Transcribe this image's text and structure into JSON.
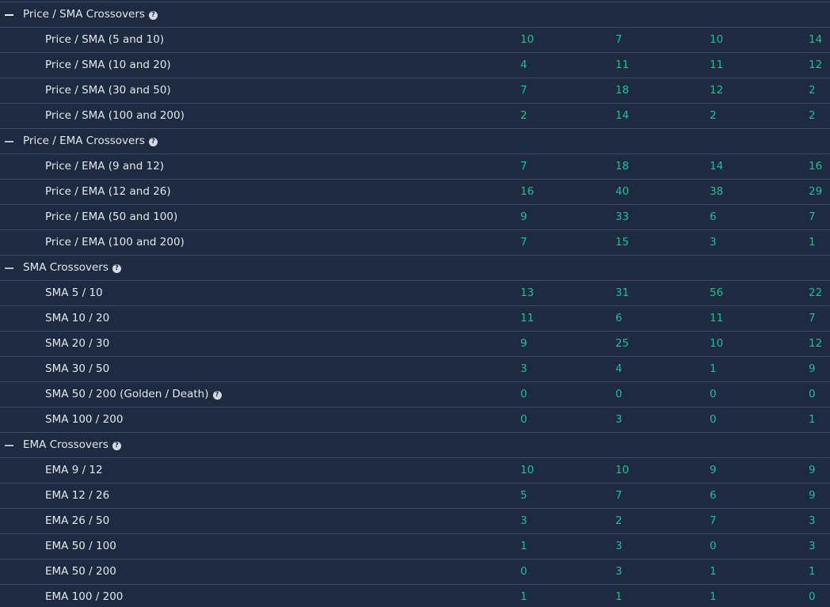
{
  "colors": {
    "background": "#1d2a3f",
    "divider": "#3b4a60",
    "label_text": "#e3e7ed",
    "value_text": "#1fbf9f"
  },
  "groups": [
    {
      "title": "Price / SMA Crossovers",
      "help_icon": "question-circle-icon",
      "rows": [
        {
          "label": "Price / SMA (5 and 10)",
          "values": [
            "10",
            "7",
            "10",
            "14"
          ]
        },
        {
          "label": "Price / SMA (10 and 20)",
          "values": [
            "4",
            "11",
            "11",
            "12"
          ]
        },
        {
          "label": "Price / SMA (30 and 50)",
          "values": [
            "7",
            "18",
            "12",
            "2"
          ]
        },
        {
          "label": "Price / SMA (100 and 200)",
          "values": [
            "2",
            "14",
            "2",
            "2"
          ]
        }
      ]
    },
    {
      "title": "Price / EMA Crossovers",
      "help_icon": "question-circle-icon",
      "rows": [
        {
          "label": "Price / EMA (9 and 12)",
          "values": [
            "7",
            "18",
            "14",
            "16"
          ]
        },
        {
          "label": "Price / EMA (12 and 26)",
          "values": [
            "16",
            "40",
            "38",
            "29"
          ]
        },
        {
          "label": "Price / EMA (50 and 100)",
          "values": [
            "9",
            "33",
            "6",
            "7"
          ]
        },
        {
          "label": "Price / EMA (100 and 200)",
          "values": [
            "7",
            "15",
            "3",
            "1"
          ]
        }
      ]
    },
    {
      "title": "SMA Crossovers",
      "help_icon": "question-circle-icon",
      "rows": [
        {
          "label": "SMA 5 / 10",
          "values": [
            "13",
            "31",
            "56",
            "22"
          ]
        },
        {
          "label": "SMA 10 / 20",
          "values": [
            "11",
            "6",
            "11",
            "7"
          ]
        },
        {
          "label": "SMA 20 / 30",
          "values": [
            "9",
            "25",
            "10",
            "12"
          ]
        },
        {
          "label": "SMA 30 / 50",
          "values": [
            "3",
            "4",
            "1",
            "9"
          ]
        },
        {
          "label": "SMA 50 / 200 (Golden / Death)",
          "values": [
            "0",
            "0",
            "0",
            "0"
          ],
          "help": true
        },
        {
          "label": "SMA 100 / 200",
          "values": [
            "0",
            "3",
            "0",
            "1"
          ]
        }
      ]
    },
    {
      "title": "EMA Crossovers",
      "help_icon": "question-circle-icon",
      "rows": [
        {
          "label": "EMA 9 / 12",
          "values": [
            "10",
            "10",
            "9",
            "9"
          ]
        },
        {
          "label": "EMA 12 / 26",
          "values": [
            "5",
            "7",
            "6",
            "9"
          ]
        },
        {
          "label": "EMA 26 / 50",
          "values": [
            "3",
            "2",
            "7",
            "3"
          ]
        },
        {
          "label": "EMA 50 / 100",
          "values": [
            "1",
            "3",
            "0",
            "3"
          ]
        },
        {
          "label": "EMA 50 / 200",
          "values": [
            "0",
            "3",
            "1",
            "1"
          ]
        },
        {
          "label": "EMA 100 / 200",
          "values": [
            "1",
            "1",
            "1",
            "0"
          ]
        }
      ]
    }
  ]
}
